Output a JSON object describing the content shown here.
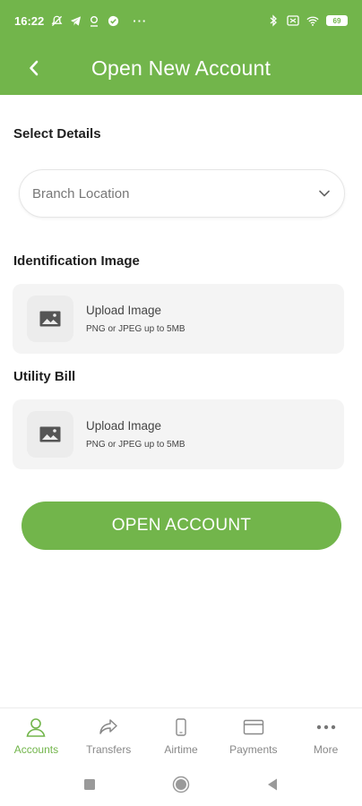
{
  "status_bar": {
    "time": "16:22",
    "more": "···",
    "battery": "69"
  },
  "header": {
    "title": "Open New Account",
    "back_icon": "chevron-left-icon"
  },
  "form": {
    "select_details_label": "Select Details",
    "branch_placeholder": "Branch Location",
    "identification_label": "Identification Image",
    "identification_upload": {
      "title": "Upload Image",
      "hint": "PNG or JPEG up to 5MB"
    },
    "utility_label": "Utility Bill",
    "utility_upload": {
      "title": "Upload Image",
      "hint": "PNG or JPEG up to 5MB"
    },
    "submit_label": "OPEN ACCOUNT"
  },
  "bottom_nav": {
    "items": [
      {
        "label": "Accounts",
        "icon": "user-icon",
        "active": true
      },
      {
        "label": "Transfers",
        "icon": "share-arrow-icon",
        "active": false
      },
      {
        "label": "Airtime",
        "icon": "phone-icon",
        "active": false
      },
      {
        "label": "Payments",
        "icon": "card-icon",
        "active": false
      },
      {
        "label": "More",
        "icon": "more-dots-icon",
        "active": false
      }
    ]
  },
  "colors": {
    "brand": "#72b54b",
    "card_bg": "#f4f4f4",
    "nav_inactive": "#888888"
  }
}
